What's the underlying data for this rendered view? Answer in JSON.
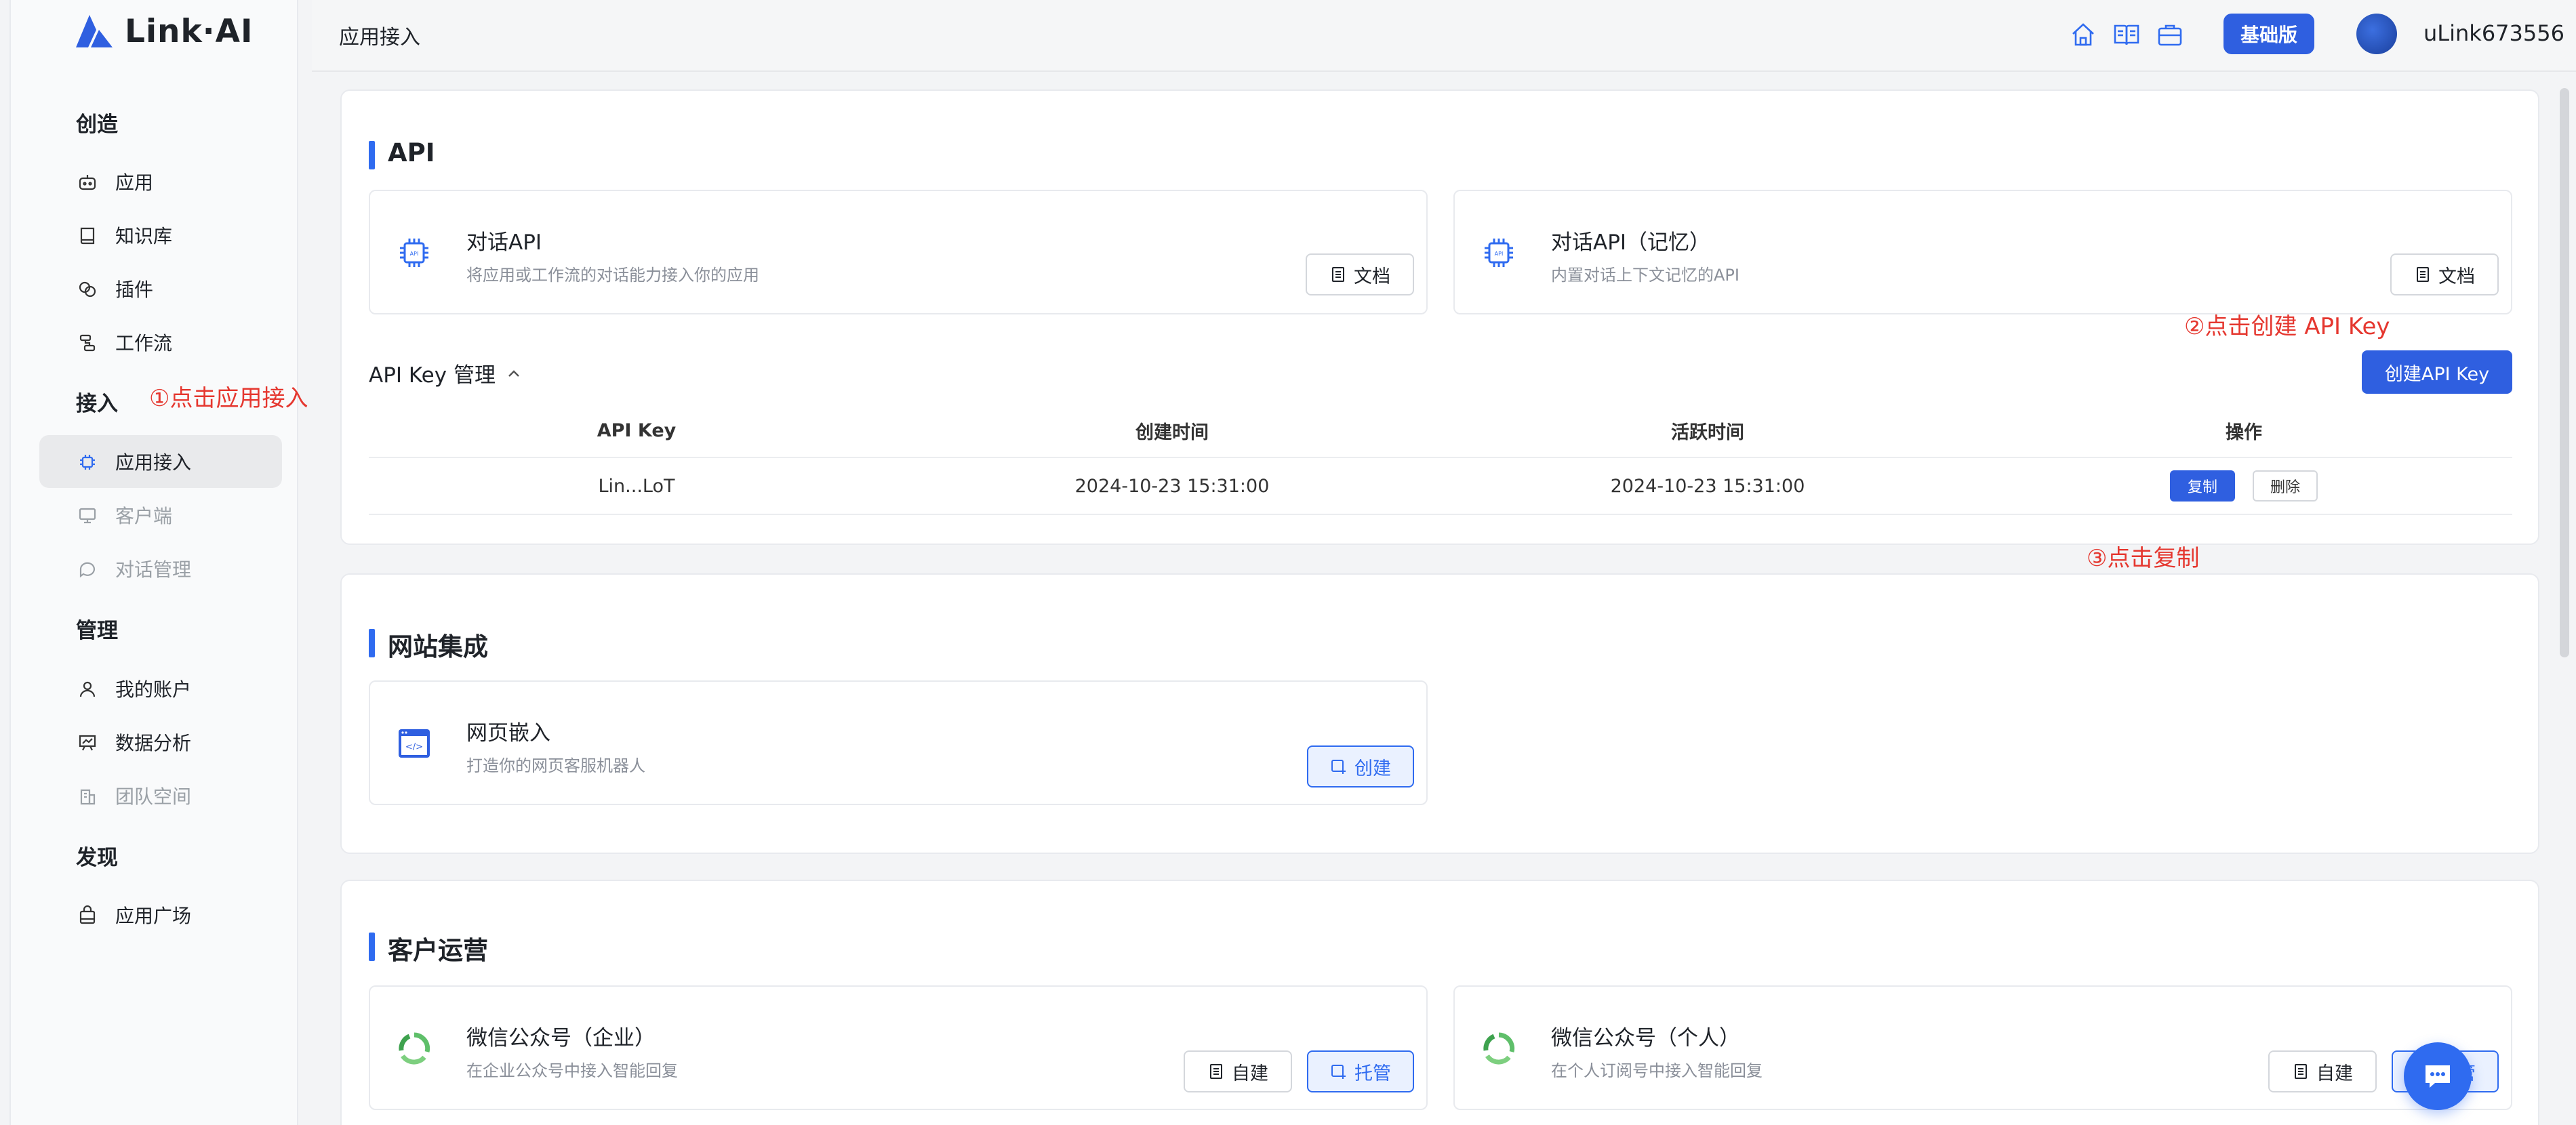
{
  "brand": {
    "name": "Link·AI"
  },
  "sidebar": {
    "sections": [
      {
        "title": "创造"
      },
      {
        "title": "接入"
      },
      {
        "title": "管理"
      },
      {
        "title": "发现"
      }
    ],
    "items": [
      {
        "label": "应用",
        "icon": "robot-icon"
      },
      {
        "label": "知识库",
        "icon": "book-icon"
      },
      {
        "label": "插件",
        "icon": "plugin-icon"
      },
      {
        "label": "工作流",
        "icon": "workflow-icon"
      },
      {
        "label": "应用接入",
        "icon": "chip-icon"
      },
      {
        "label": "客户端",
        "icon": "monitor-icon"
      },
      {
        "label": "对话管理",
        "icon": "chat-bubble-icon"
      },
      {
        "label": "我的账户",
        "icon": "user-icon"
      },
      {
        "label": "数据分析",
        "icon": "chart-icon"
      },
      {
        "label": "团队空间",
        "icon": "building-icon"
      },
      {
        "label": "应用广场",
        "icon": "store-icon"
      }
    ]
  },
  "header": {
    "title": "应用接入",
    "plan_label": "基础版",
    "username": "uLink673556"
  },
  "annotations": {
    "step1": "①点击应用接入",
    "step2": "②点击创建 API Key",
    "step3": "③点击复制"
  },
  "api_section": {
    "title": "API",
    "cards": [
      {
        "title": "对话API",
        "desc": "将应用或工作流的对话能力接入你的应用",
        "button": "文档"
      },
      {
        "title": "对话API（记忆）",
        "desc": "内置对话上下文记忆的API",
        "button": "文档"
      }
    ],
    "key_manage_label": "API Key 管理",
    "create_key_button": "创建API Key",
    "table": {
      "headers": [
        "API Key",
        "创建时间",
        "活跃时间",
        "操作"
      ],
      "rows": [
        {
          "key": "Lin...LoT",
          "created": "2024-10-23 15:31:00",
          "active": "2024-10-23 15:31:00",
          "copy": "复制",
          "delete": "删除"
        }
      ]
    }
  },
  "web_section": {
    "title": "网站集成",
    "cards": [
      {
        "title": "网页嵌入",
        "desc": "打造你的网页客服机器人",
        "button": "创建"
      }
    ]
  },
  "customer_section": {
    "title": "客户运营",
    "cards": [
      {
        "title": "微信公众号（企业）",
        "desc": "在企业公众号中接入智能回复",
        "button_self": "自建",
        "button_hosted": "托管"
      },
      {
        "title": "微信公众号（个人）",
        "desc": "在个人订阅号中接入智能回复",
        "button_self": "自建",
        "button_hosted": "托管"
      }
    ]
  },
  "colors": {
    "accent": "#2f6bf0",
    "annotation": "#e5372f"
  }
}
